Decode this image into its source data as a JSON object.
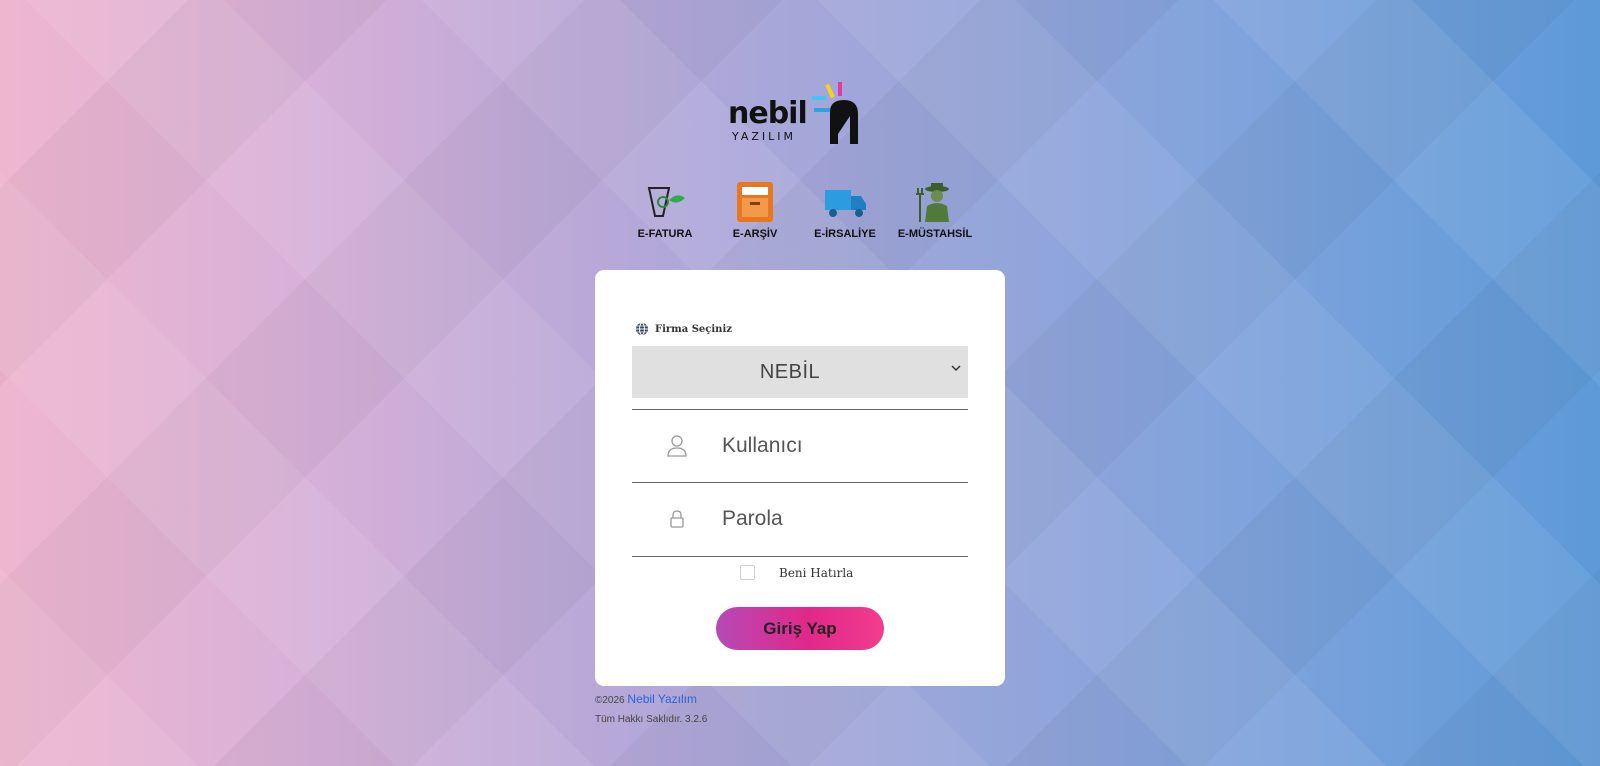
{
  "brand": {
    "logo_text": "nebil",
    "logo_subtext": "YAZILIM",
    "mark_letter": "N"
  },
  "modules": [
    {
      "label": "E-FATURA",
      "icon": "e-invoice-icon"
    },
    {
      "label": "E-ARŞİV",
      "icon": "archive-box-icon"
    },
    {
      "label": "E-İRSALİYE",
      "icon": "delivery-truck-icon"
    },
    {
      "label": "E-MÜSTAHSİL",
      "icon": "farmer-icon"
    }
  ],
  "login": {
    "firm_label": "Firma Seçiniz",
    "firm_selected": "NEBİL",
    "username_placeholder": "Kullanıcı",
    "password_placeholder": "Parola",
    "remember_label": "Beni Hatırla",
    "submit_label": "Giriş Yap"
  },
  "footer": {
    "copyright": "©2026",
    "company": "Nebil Yazılım",
    "rights": "Tüm Hakkı Saklıdır. 3.2.6"
  },
  "colors": {
    "button_start": "#b54ab6",
    "button_end": "#f23d8e",
    "link": "#2b63d6",
    "select_bg": "#e0e0e0"
  }
}
